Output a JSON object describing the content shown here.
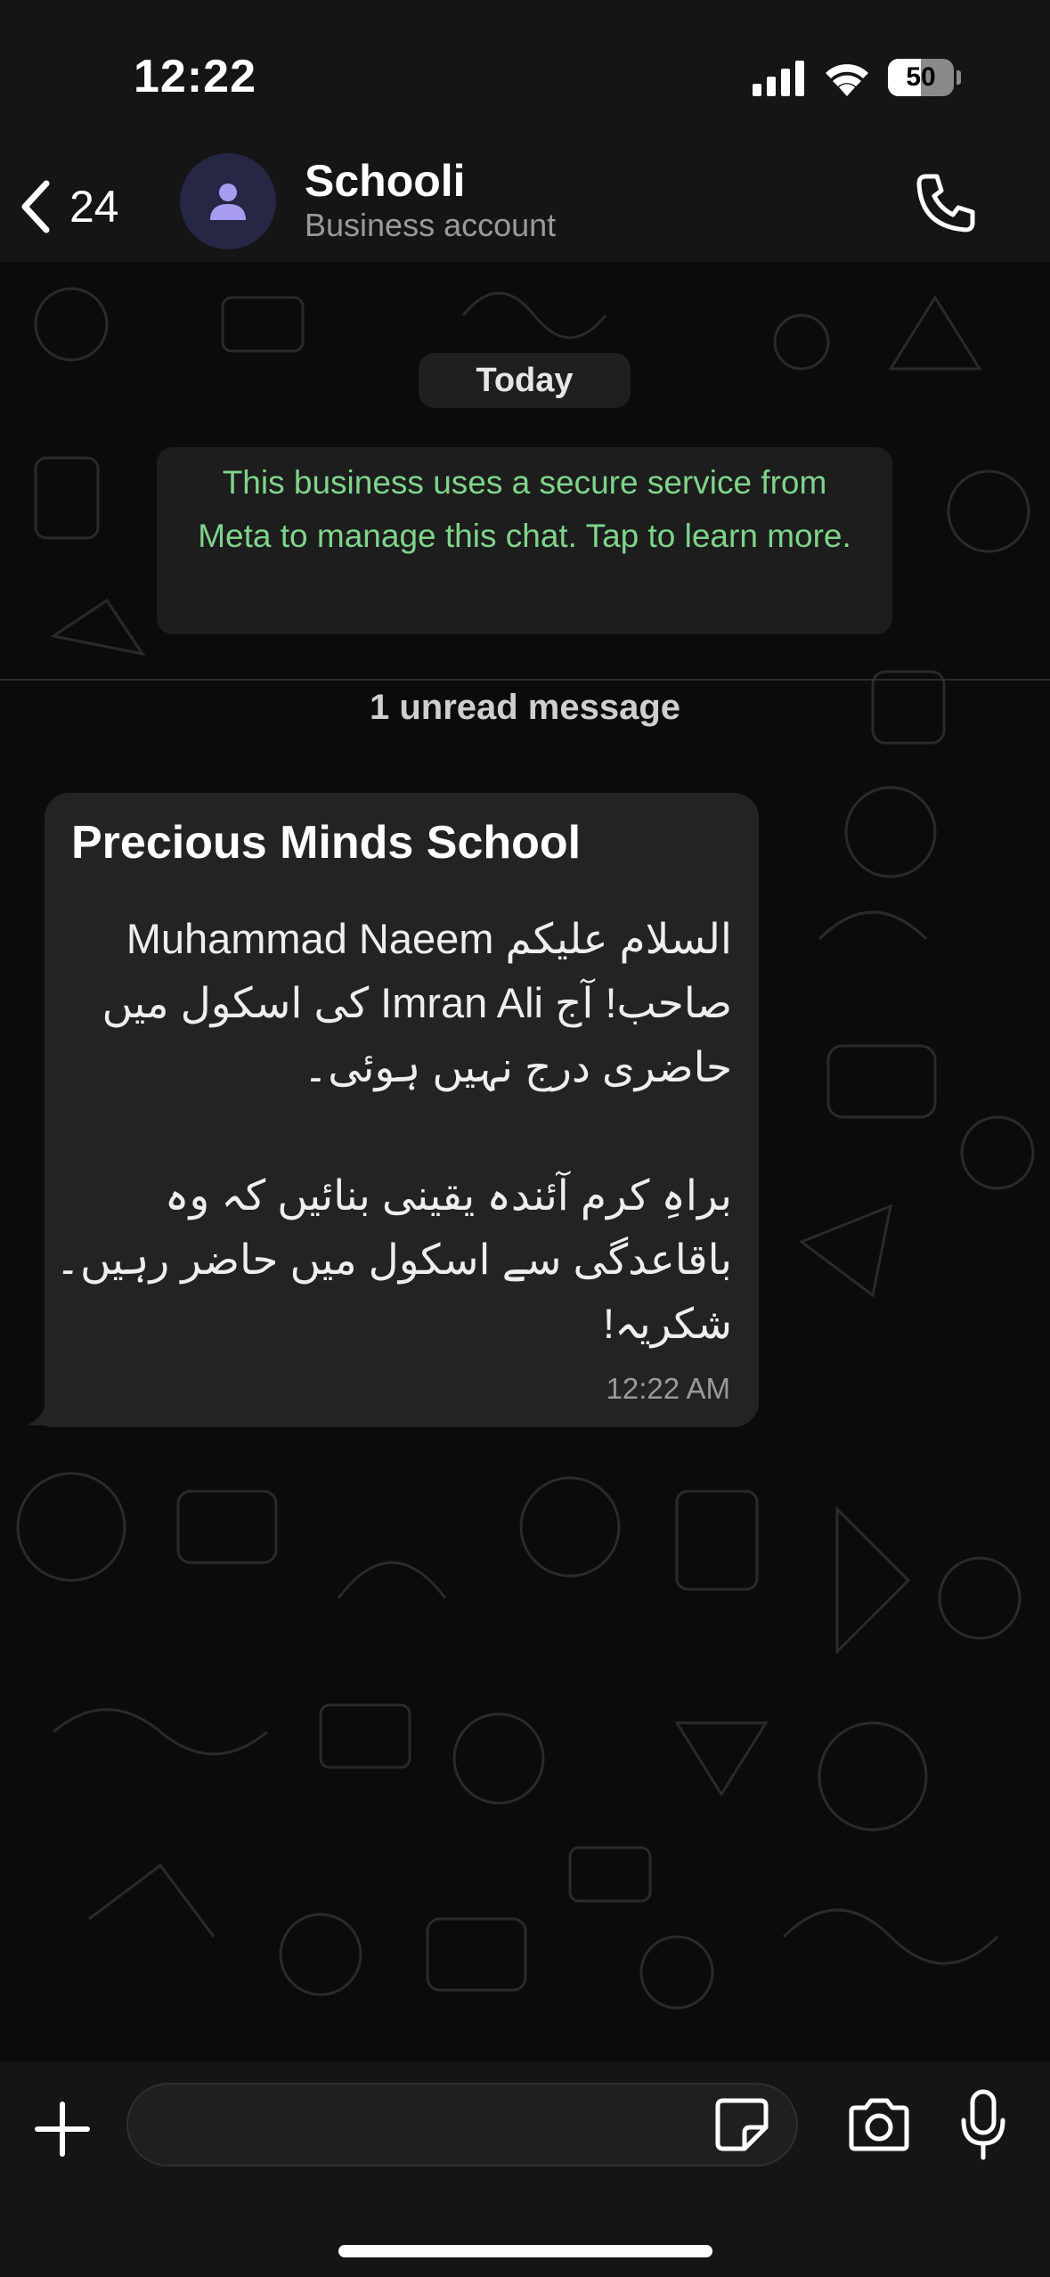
{
  "status_bar": {
    "time": "12:22",
    "battery_level": "50",
    "icons": [
      "signal-icon",
      "wifi-icon",
      "battery-icon"
    ]
  },
  "header": {
    "back_count": "24",
    "contact_name": "Schooli",
    "contact_subtitle": "Business account",
    "icons": [
      "back-chevron-icon",
      "person-avatar-icon",
      "phone-icon"
    ]
  },
  "chat": {
    "date_label": "Today",
    "notice_text": "This business uses a secure service from Meta to manage this chat. Tap to learn more.",
    "unread_label": "1 unread message",
    "message": {
      "title": "Precious Minds School",
      "lines": [
        "السلام علیکم Muhammad Naeem",
        "صاحب! آج Imran Ali کی اسکول میں",
        "حاضری درج نہیں ہوئی۔",
        "",
        "براہِ کرم آئندہ یقینی بنائیں کہ وہ",
        "باقاعدگی سے اسکول میں حاضر رہیں۔",
        "شکریہ!"
      ],
      "time": "12:22 AM"
    }
  },
  "composer": {
    "input_value": "",
    "icons": [
      "plus-icon",
      "sticker-icon",
      "camera-icon",
      "microphone-icon"
    ]
  },
  "colors": {
    "background": "#0b0b0b",
    "bar": "#151515",
    "bubble": "#232323",
    "notice_text": "#7fd48b",
    "avatar_accent": "#a89cf0"
  }
}
